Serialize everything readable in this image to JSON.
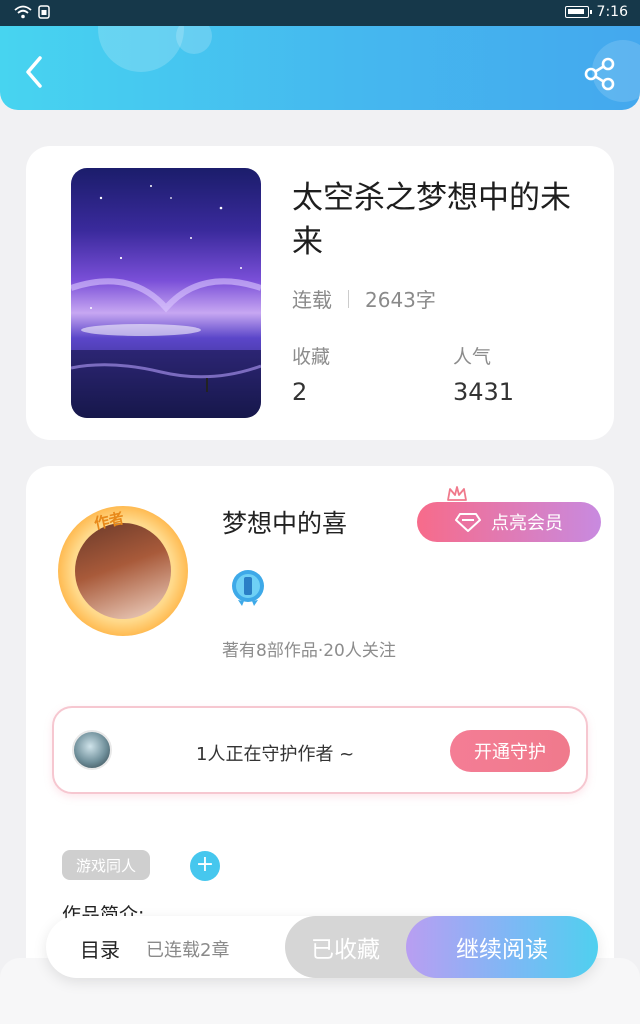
{
  "status_bar": {
    "time": "7:16"
  },
  "book": {
    "title": "太空杀之梦想中的未来",
    "status": "连载",
    "word_count": "2643字",
    "favorites_label": "收藏",
    "favorites_value": "2",
    "popularity_label": "人气",
    "popularity_value": "3431"
  },
  "author": {
    "tag": "作者",
    "name": "梦想中的喜",
    "vip_button": "点亮会员",
    "stats": "著有8部作品·20人关注",
    "guard_text": "1人正在守护作者 ~",
    "guard_button": "开通守护"
  },
  "tags": {
    "items": [
      "游戏同人"
    ],
    "add_symbol": "+"
  },
  "intro_label": "作品简介:",
  "bottom_bar": {
    "toc_label": "目录",
    "chapter_count": "已连载2章",
    "favorited_button": "已收藏",
    "read_button": "继续阅读"
  },
  "colors": {
    "header_start": "#47d4f0",
    "header_end": "#44a8ee",
    "vip_start": "#f76b8a",
    "vip_end": "#c88ae0",
    "guard_button": "#f47d95",
    "read_start": "#b99ef2",
    "read_end": "#4fd0ef"
  },
  "icons": [
    "wifi-icon",
    "sim-icon",
    "battery-icon",
    "back-arrow-icon",
    "share-icon",
    "crown-icon",
    "diamond-icon",
    "level-badge-icon",
    "plus-icon"
  ]
}
